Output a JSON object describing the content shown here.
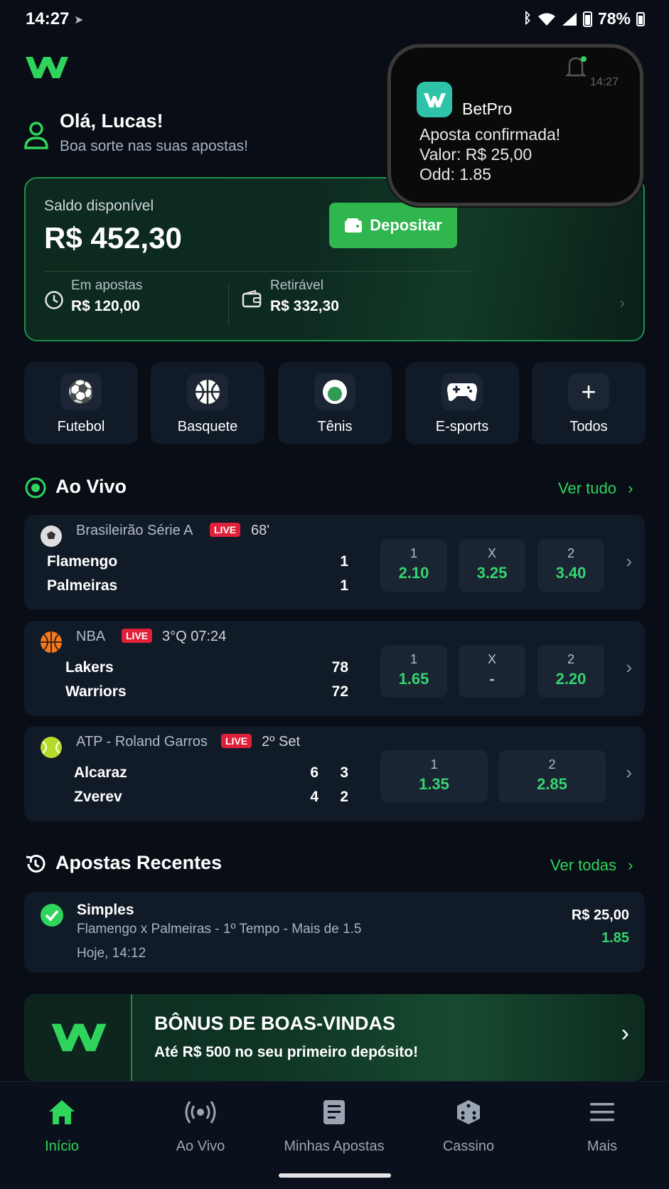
{
  "status_bar": {
    "time": "14:27",
    "battery": "78%"
  },
  "greeting": {
    "title": "Olá, Lucas!",
    "subtitle": "Boa sorte nas suas apostas!"
  },
  "balance": {
    "label": "Saldo disponível",
    "value": "R$ 452,30",
    "deposit_label": "Depositar",
    "in_bets_label": "Em apostas",
    "in_bets_value": "R$ 120,00",
    "withdrawable_label": "Retirável",
    "withdrawable_value": "R$ 332,30"
  },
  "notification": {
    "app": "BetPro",
    "time": "14:27",
    "line1": "Aposta confirmada!",
    "line2": "Valor: R$ 25,00",
    "line3": "Odd: 1.85"
  },
  "sports": [
    {
      "label": "Futebol",
      "icon": "soccer-ball-icon"
    },
    {
      "label": "Basquete",
      "icon": "basketball-icon"
    },
    {
      "label": "Tênis",
      "icon": "tennis-ball-icon"
    },
    {
      "label": "E-sports",
      "icon": "gamepad-icon"
    },
    {
      "label": "Todos",
      "icon": "plus-icon"
    }
  ],
  "live": {
    "title": "Ao Vivo",
    "see_all": "Ver tudo",
    "live_badge": "LIVE",
    "matches": [
      {
        "league": "Brasileirão Série A",
        "time": "68'",
        "team1": "Flamengo",
        "team2": "Palmeiras",
        "score1": "1",
        "score2": "1",
        "odds": [
          {
            "label": "1",
            "value": "2.10"
          },
          {
            "label": "X",
            "value": "3.25"
          },
          {
            "label": "2",
            "value": "3.40"
          }
        ]
      },
      {
        "league": "NBA",
        "time": "3°Q 07:24",
        "team1": "Lakers",
        "team2": "Warriors",
        "score1": "78",
        "score2": "72",
        "odds": [
          {
            "label": "1",
            "value": "1.65"
          },
          {
            "label": "X",
            "value": "-"
          },
          {
            "label": "2",
            "value": "2.20"
          }
        ]
      },
      {
        "league": "ATP - Roland Garros",
        "time": "2º Set",
        "team1": "Alcaraz",
        "team2": "Zverev",
        "set1_p1": "6",
        "set2_p1": "3",
        "set1_p2": "4",
        "set2_p2": "2",
        "odds": [
          {
            "label": "1",
            "value": "1.35"
          },
          {
            "label": "2",
            "value": "2.85"
          }
        ]
      }
    ]
  },
  "recent": {
    "title": "Apostas Recentes",
    "see_all": "Ver todas",
    "bet": {
      "type": "Simples",
      "desc": "Flamengo x Palmeiras - 1º Tempo - Mais de 1.5",
      "date": "Hoje, 14:12",
      "amount": "R$ 25,00",
      "odd": "1.85"
    }
  },
  "promo": {
    "title": "BÔNUS DE BOAS-VINDAS",
    "subtitle": "Até R$ 500 no seu primeiro depósito!"
  },
  "nav": [
    {
      "label": "Início",
      "icon": "home-icon"
    },
    {
      "label": "Ao Vivo",
      "icon": "broadcast-icon"
    },
    {
      "label": "Minhas Apostas",
      "icon": "receipt-icon"
    },
    {
      "label": "Cassino",
      "icon": "dice-icon"
    },
    {
      "label": "Mais",
      "icon": "menu-icon"
    }
  ],
  "colors": {
    "accent": "#2fd45c",
    "live": "#e0203a",
    "card": "#111a27",
    "background": "#080d16"
  }
}
